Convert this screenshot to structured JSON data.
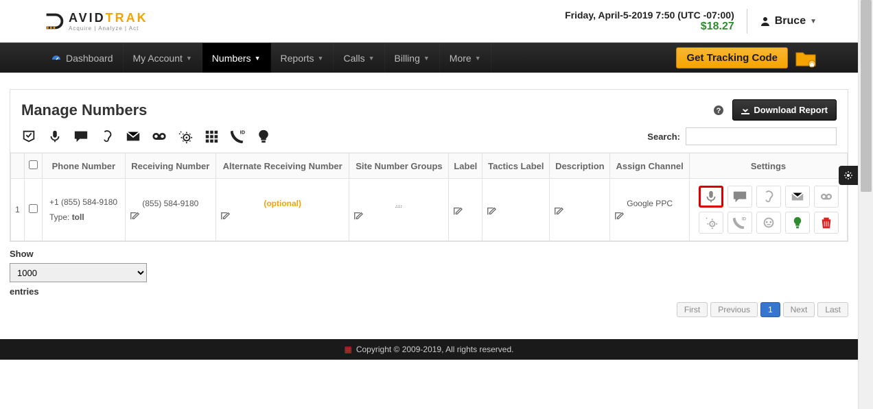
{
  "header": {
    "logo_main_a": "AVID",
    "logo_main_b": "TRAK",
    "logo_sub": "Acquire | Analyze | Act",
    "datetime": "Friday, April-5-2019 7:50 (UTC -07:00)",
    "balance": "$18.27",
    "user": "Bruce"
  },
  "nav": {
    "dashboard": "Dashboard",
    "my_account": "My Account",
    "numbers": "Numbers",
    "reports": "Reports",
    "calls": "Calls",
    "billing": "Billing",
    "more": "More",
    "tracking_btn": "Get Tracking Code"
  },
  "panel": {
    "title": "Manage Numbers",
    "download": "Download Report",
    "search_label": "Search:"
  },
  "columns": {
    "c1": "Phone Number",
    "c2": "Receiving Number",
    "c3": "Alternate Receiving Number",
    "c4": "Site Number Groups",
    "c5": "Label",
    "c6": "Tactics Label",
    "c7": "Description",
    "c8": "Assign Channel",
    "c9": "Settings"
  },
  "rows": [
    {
      "idx": "1",
      "phone": "+1 (855) 584-9180",
      "type_label": "Type: ",
      "type_value": "toll",
      "receiving": "(855) 584-9180",
      "alt": "(optional)",
      "groups": "...",
      "channel": "Google PPC"
    }
  ],
  "show": {
    "label1": "Show",
    "value": "1000",
    "label2": "entries"
  },
  "pager": {
    "first": "First",
    "prev": "Previous",
    "p1": "1",
    "next": "Next",
    "last": "Last"
  },
  "footer": "Copyright © 2009-2019, All rights reserved."
}
